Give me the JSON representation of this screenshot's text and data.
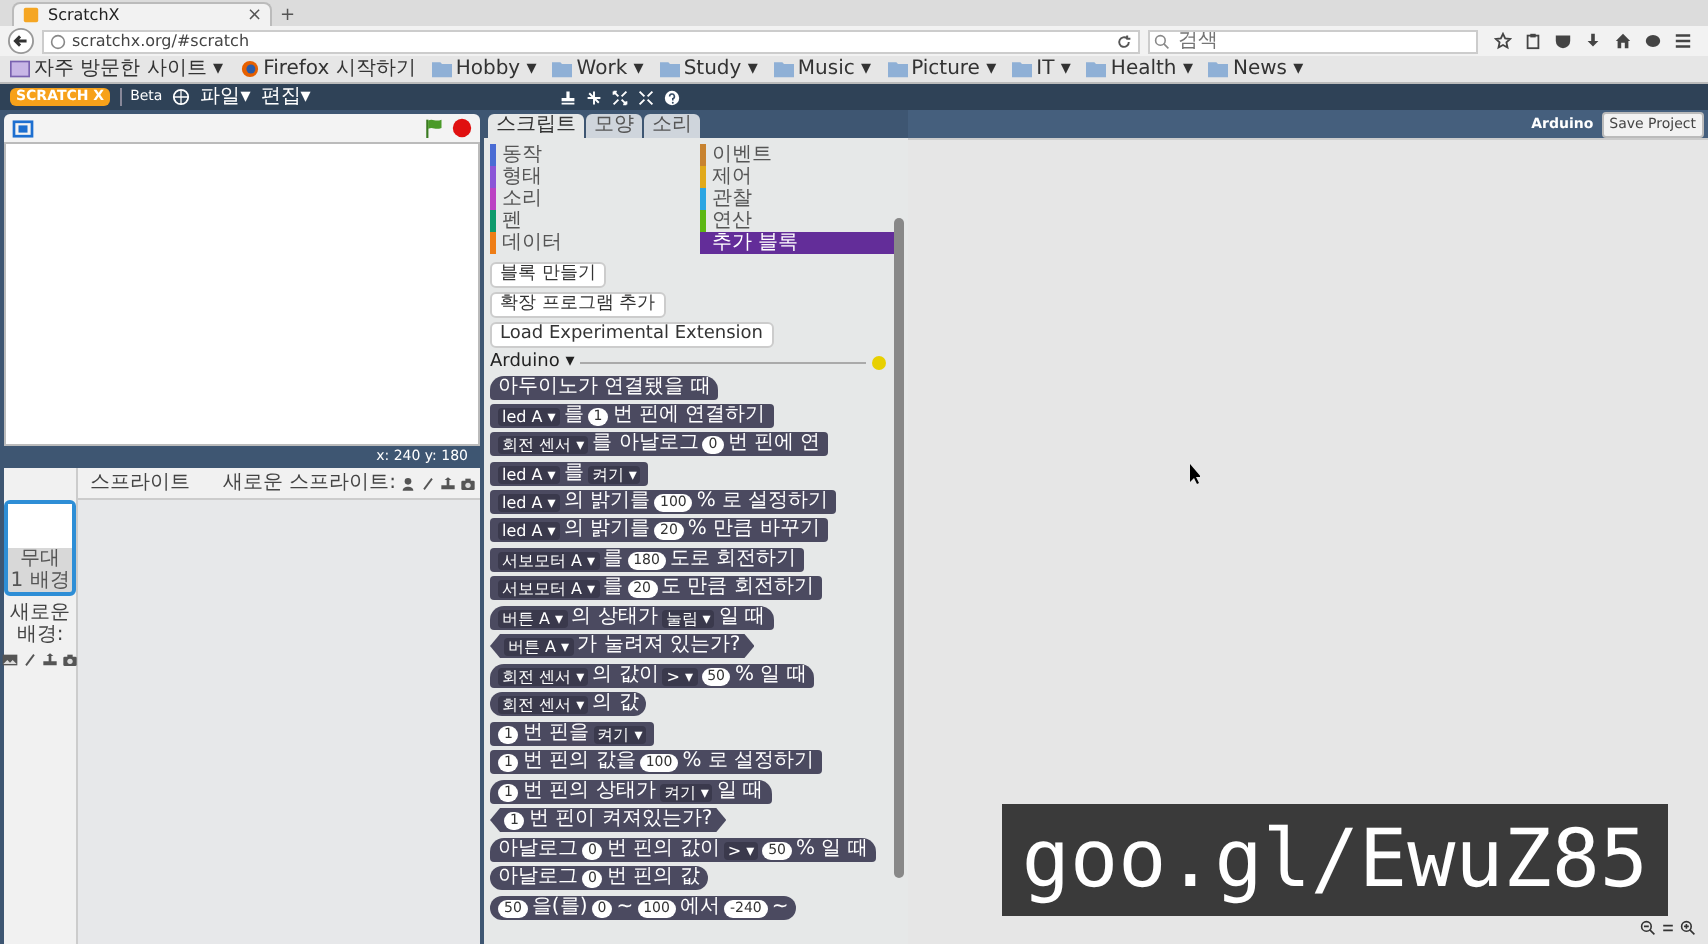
{
  "browser": {
    "tab": {
      "title": "ScratchX",
      "close": "×"
    },
    "new_tab": "+",
    "url": "scratchx.org/#scratch",
    "search": {
      "placeholder": "검색"
    },
    "bookmarks": [
      {
        "kind": "frequent",
        "label": "자주 방문한 사이트 ▾"
      },
      {
        "kind": "firefox",
        "label": "Firefox 시작하기"
      },
      {
        "kind": "folder",
        "label": "Hobby ▾"
      },
      {
        "kind": "folder",
        "label": "Work ▾"
      },
      {
        "kind": "folder",
        "label": "Study ▾"
      },
      {
        "kind": "folder",
        "label": "Music ▾"
      },
      {
        "kind": "folder",
        "label": "Picture ▾"
      },
      {
        "kind": "folder",
        "label": "IT ▾"
      },
      {
        "kind": "folder",
        "label": "Health ▾"
      },
      {
        "kind": "folder",
        "label": "News ▾"
      }
    ]
  },
  "menu_bar": {
    "logo": "SCRATCH X",
    "beta": "Beta",
    "menus": [
      "파일▾",
      "편집▾"
    ]
  },
  "stage": {
    "coords": "x: 240  y: 180"
  },
  "sprites": {
    "title": "스프라이트",
    "new_sprite": "새로운 스프라이트:",
    "stage_item": {
      "name": "무대",
      "backdrops": "1 배경",
      "selected": true
    },
    "new_backdrop": "새로운 배경:"
  },
  "tabs": [
    {
      "label": "스크립트",
      "selected": true
    },
    {
      "label": "모양",
      "selected": false
    },
    {
      "label": "소리",
      "selected": false
    }
  ],
  "categories": [
    {
      "label": "동작",
      "color": "#4a6cd4",
      "selected": false
    },
    {
      "label": "형태",
      "color": "#8a55d7",
      "selected": false
    },
    {
      "label": "소리",
      "color": "#bb42c3",
      "selected": false
    },
    {
      "label": "펜",
      "color": "#0e9a6c",
      "selected": false
    },
    {
      "label": "데이터",
      "color": "#ee7d16",
      "selected": false
    },
    {
      "label": "이벤트",
      "color": "#c88330",
      "selected": false
    },
    {
      "label": "제어",
      "color": "#e1a91a",
      "selected": false
    },
    {
      "label": "관찰",
      "color": "#2ca5e2",
      "selected": false
    },
    {
      "label": "연산",
      "color": "#5cb712",
      "selected": false
    },
    {
      "label": "추가 블록",
      "color": "#632d99",
      "selected": true
    }
  ],
  "palette": {
    "buttons": [
      "블록 만들기",
      "확장 프로그램 추가",
      "Load Experimental Extension"
    ],
    "extension": {
      "name": "Arduino ▾",
      "ready": false
    },
    "block_groups": [
      [
        {
          "kind": "hat",
          "parts": [
            {
              "kind": "text",
              "text": "아두이노가 연결됐을 때"
            }
          ]
        },
        {
          "kind": "command",
          "parts": [
            {
              "kind": "dropdown",
              "text": "led A ▾"
            },
            {
              "kind": "text",
              "text": "를"
            },
            {
              "kind": "number",
              "text": "1"
            },
            {
              "kind": "text",
              "text": "번 핀에 연결하기"
            }
          ]
        },
        {
          "kind": "command",
          "parts": [
            {
              "kind": "dropdown",
              "text": "회전 센서 ▾"
            },
            {
              "kind": "text",
              "text": "를 아날로그"
            },
            {
              "kind": "number",
              "text": "0"
            },
            {
              "kind": "text",
              "text": "번 핀에 연"
            }
          ]
        }
      ],
      [
        {
          "kind": "command",
          "parts": [
            {
              "kind": "dropdown",
              "text": "led A ▾"
            },
            {
              "kind": "text",
              "text": "를"
            },
            {
              "kind": "dropdown",
              "text": "켜기 ▾"
            }
          ]
        },
        {
          "kind": "command",
          "parts": [
            {
              "kind": "dropdown",
              "text": "led A ▾"
            },
            {
              "kind": "text",
              "text": "의 밝기를"
            },
            {
              "kind": "number",
              "text": "100"
            },
            {
              "kind": "text",
              "text": "% 로 설정하기"
            }
          ]
        },
        {
          "kind": "command",
          "parts": [
            {
              "kind": "dropdown",
              "text": "led A ▾"
            },
            {
              "kind": "text",
              "text": "의 밝기를"
            },
            {
              "kind": "number",
              "text": "20"
            },
            {
              "kind": "text",
              "text": "% 만큼 바꾸기"
            }
          ]
        }
      ],
      [
        {
          "kind": "command",
          "parts": [
            {
              "kind": "dropdown",
              "text": "서보모터 A ▾"
            },
            {
              "kind": "text",
              "text": "를"
            },
            {
              "kind": "number",
              "text": "180"
            },
            {
              "kind": "text",
              "text": "도로 회전하기"
            }
          ]
        },
        {
          "kind": "command",
          "parts": [
            {
              "kind": "dropdown",
              "text": "서보모터 A ▾"
            },
            {
              "kind": "text",
              "text": "를"
            },
            {
              "kind": "number",
              "text": "20"
            },
            {
              "kind": "text",
              "text": "도 만큼 회전하기"
            }
          ]
        }
      ],
      [
        {
          "kind": "hat",
          "parts": [
            {
              "kind": "dropdown",
              "text": "버튼 A ▾"
            },
            {
              "kind": "text",
              "text": "의 상태가"
            },
            {
              "kind": "dropdown",
              "text": "눌림 ▾"
            },
            {
              "kind": "text",
              "text": "일 때"
            }
          ]
        },
        {
          "kind": "boolean",
          "parts": [
            {
              "kind": "dropdown",
              "text": "버튼 A ▾"
            },
            {
              "kind": "text",
              "text": "가 눌려져 있는가?"
            }
          ]
        }
      ],
      [
        {
          "kind": "hat",
          "parts": [
            {
              "kind": "dropdown",
              "text": "회전 센서 ▾"
            },
            {
              "kind": "text",
              "text": "의 값이"
            },
            {
              "kind": "dropdown",
              "text": "> ▾"
            },
            {
              "kind": "number",
              "text": "50"
            },
            {
              "kind": "text",
              "text": "% 일 때"
            }
          ]
        },
        {
          "kind": "reporter",
          "parts": [
            {
              "kind": "dropdown",
              "text": "회전 센서 ▾"
            },
            {
              "kind": "text",
              "text": "의 값"
            }
          ]
        }
      ],
      [
        {
          "kind": "command",
          "parts": [
            {
              "kind": "number",
              "text": "1"
            },
            {
              "kind": "text",
              "text": "번 핀을"
            },
            {
              "kind": "dropdown",
              "text": "켜기 ▾"
            }
          ]
        },
        {
          "kind": "command",
          "parts": [
            {
              "kind": "number",
              "text": "1"
            },
            {
              "kind": "text",
              "text": "번 핀의 값을"
            },
            {
              "kind": "number",
              "text": "100"
            },
            {
              "kind": "text",
              "text": "% 로 설정하기"
            }
          ]
        }
      ],
      [
        {
          "kind": "hat",
          "parts": [
            {
              "kind": "number",
              "text": "1"
            },
            {
              "kind": "text",
              "text": "번 핀의 상태가"
            },
            {
              "kind": "dropdown",
              "text": "켜기 ▾"
            },
            {
              "kind": "text",
              "text": "일 때"
            }
          ]
        },
        {
          "kind": "boolean",
          "parts": [
            {
              "kind": "number",
              "text": "1"
            },
            {
              "kind": "text",
              "text": "번 핀이 켜져있는가?"
            }
          ]
        }
      ],
      [
        {
          "kind": "hat",
          "parts": [
            {
              "kind": "text",
              "text": "아날로그"
            },
            {
              "kind": "number",
              "text": "0"
            },
            {
              "kind": "text",
              "text": "번 핀의 값이"
            },
            {
              "kind": "dropdown",
              "text": "> ▾"
            },
            {
              "kind": "number",
              "text": "50"
            },
            {
              "kind": "text",
              "text": "% 일 때"
            }
          ]
        },
        {
          "kind": "reporter",
          "parts": [
            {
              "kind": "text",
              "text": "아날로그"
            },
            {
              "kind": "number",
              "text": "0"
            },
            {
              "kind": "text",
              "text": "번 핀의 값"
            }
          ]
        }
      ],
      [
        {
          "kind": "reporter",
          "parts": [
            {
              "kind": "number",
              "text": "50"
            },
            {
              "kind": "text",
              "text": "을(를)"
            },
            {
              "kind": "number",
              "text": "0"
            },
            {
              "kind": "text",
              "text": "~"
            },
            {
              "kind": "number",
              "text": "100"
            },
            {
              "kind": "text",
              "text": "에서"
            },
            {
              "kind": "number",
              "text": "-240"
            },
            {
              "kind": "text",
              "text": "~"
            }
          ]
        }
      ]
    ]
  },
  "scripts": {
    "device": "Arduino",
    "save_button": "Save Project"
  },
  "overlay": "goo.gl/EwuZ85"
}
